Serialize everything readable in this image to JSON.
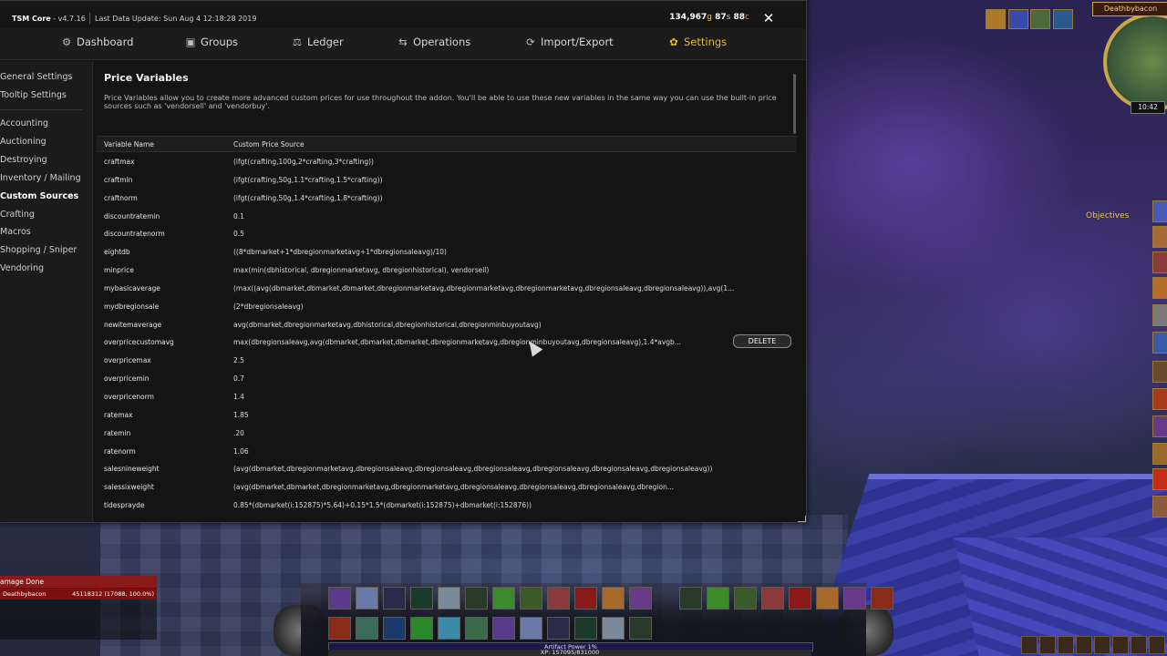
{
  "window": {
    "app_name": "TSM Core",
    "version": " - v4.7.16",
    "last_update": "Last Data Update: Sun Aug  4 12:18:28 2019",
    "gold": "134,967",
    "gold_unit": "g",
    "silver": "87",
    "silver_unit": "s",
    "copper": "88",
    "copper_unit": "c",
    "close_label": "✕"
  },
  "nav": {
    "tabs": [
      {
        "label": "Dashboard",
        "icon": "⚙"
      },
      {
        "label": "Groups",
        "icon": "▣"
      },
      {
        "label": "Ledger",
        "icon": "⚖"
      },
      {
        "label": "Operations",
        "icon": "⇆"
      },
      {
        "label": "Import/Export",
        "icon": "⟳"
      },
      {
        "label": "Settings",
        "icon": "✿"
      }
    ],
    "active": "Settings"
  },
  "sidebar": {
    "items": [
      "General Settings",
      "Tooltip Settings",
      "Accounting",
      "Auctioning",
      "Destroying",
      "Inventory / Mailing",
      "Custom Sources",
      "Crafting",
      "Macros",
      "Shopping / Sniper",
      "Vendoring"
    ],
    "active": "Custom Sources"
  },
  "content": {
    "title": "Price Variables",
    "description": "Price Variables allow you to create more advanced custom prices for use throughout the addon. You'll be able to use these new variables in the same way you can use the built-in price sources such as 'vendorsell' and 'vendorbuy'.",
    "columns": [
      "Variable Name",
      "Custom Price Source"
    ],
    "delete_label": "DELETE",
    "rows": [
      {
        "name": "craftmax",
        "source": "(ifgt(crafting,100g,2*crafting,3*crafting))"
      },
      {
        "name": "craftmin",
        "source": "(ifgt(crafting,50g,1.1*crafting,1.5*crafting))"
      },
      {
        "name": "craftnorm",
        "source": "(ifgt(crafting,50g,1.4*crafting,1.8*crafting))"
      },
      {
        "name": "discountratemin",
        "source": "0.1"
      },
      {
        "name": "discountratenorm",
        "source": "0.5"
      },
      {
        "name": "eightdb",
        "source": "((8*dbmarket+1*dbregionmarketavg+1*dbregionsaleavg)/10)"
      },
      {
        "name": "minprice",
        "source": "max(min(dbhistorical, dbregionmarketavg, dbregionhistorical), vendorsell)"
      },
      {
        "name": "mybasicaverage",
        "source": "(max((avg(dbmarket,dbmarket,dbmarket,dbregionmarketavg,dbregionmarketavg,dbregionmarketavg,dbregionsaleavg,dbregionsaleavg)),avg(1..."
      },
      {
        "name": "mydbregionsale",
        "source": "(2*dbregionsaleavg)"
      },
      {
        "name": "newitemaverage",
        "source": "avg(dbmarket,dbregionmarketavg,dbhistorical,dbregionhistorical,dbregionminbuyoutavg)"
      },
      {
        "name": "overpricecustomavg",
        "source": "max(dbregionsaleavg,avg(dbmarket,dbmarket,dbmarket,dbregionmarketavg,dbregionminbuyoutavg,dbregionsaleavg),1.4*avgb..."
      },
      {
        "name": "overpricemax",
        "source": "2.5"
      },
      {
        "name": "overpricemin",
        "source": "0.7"
      },
      {
        "name": "overpricenorm",
        "source": "1.4"
      },
      {
        "name": "ratemax",
        "source": "1.85"
      },
      {
        "name": "ratemin",
        "source": ".20"
      },
      {
        "name": "ratenorm",
        "source": "1.06"
      },
      {
        "name": "salesnineweight",
        "source": "(avg(dbmarket,dbregionmarketavg,dbregionsaleavg,dbregionsaleavg,dbregionsaleavg,dbregionsaleavg,dbregionsaleavg,dbregionsaleavg))"
      },
      {
        "name": "salessixweight",
        "source": "(avg(dbmarket,dbmarket,dbregionmarketavg,dbregionmarketavg,dbregionsaleavg,dbregionsaleavg,dbregionsaleavg,dbregion..."
      },
      {
        "name": "tidesprayde",
        "source": "0.85*(dbmarket(i:152875)*5.64)+0.15*1.5*(dbmarket(i:152875)+dbmarket(i:152876))"
      }
    ]
  },
  "game_ui": {
    "player_name": "Deathbybacon",
    "clock": "10:42",
    "objectives_label": "Objectives",
    "damage_meter": {
      "title": "amage Done",
      "player": "Deathbybacon",
      "value": "45118312 (17088, 100.0%)"
    },
    "artifact_label": "Artifact Power 1%",
    "xp_label": "XP: 157095/831000"
  }
}
